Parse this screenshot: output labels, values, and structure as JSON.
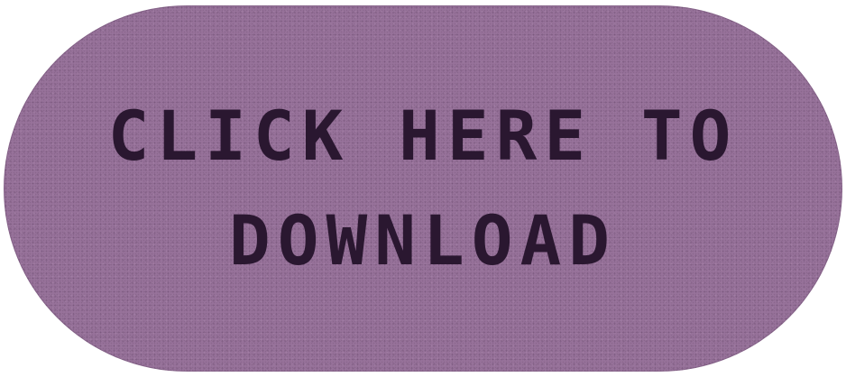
{
  "button": {
    "line1": "CLICK HERE TO",
    "line2": "DOWNLOAD",
    "background_color": "#97729a",
    "text_color": "#2a1730"
  }
}
